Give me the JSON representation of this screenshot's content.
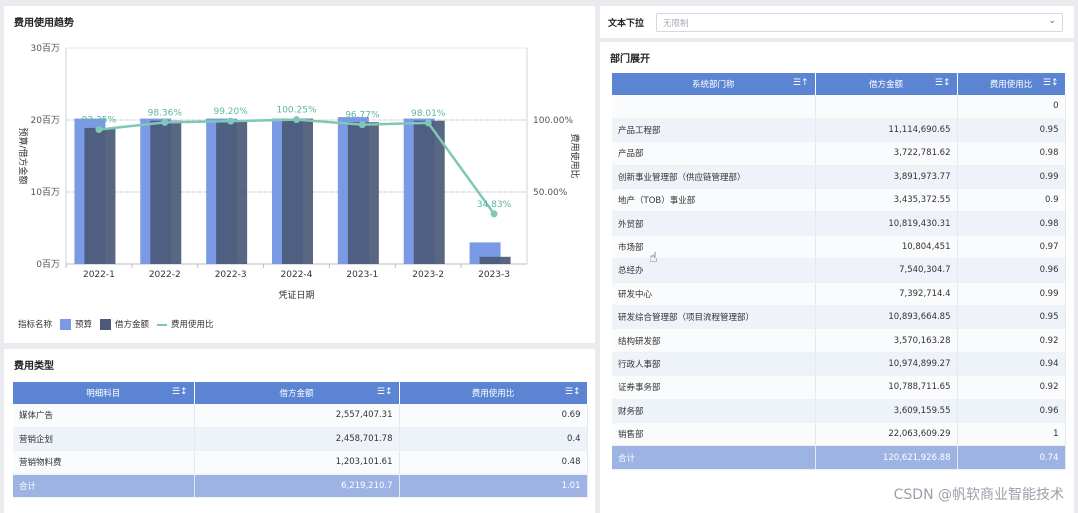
{
  "trend_panel": {
    "title": "费用使用趋势",
    "legend": {
      "label": "指标名称",
      "items": [
        "预算",
        "借方金额",
        "费用使用比"
      ]
    }
  },
  "chart_data": {
    "type": "bar",
    "categories": [
      "2022-1",
      "2022-2",
      "2022-3",
      "2022-4",
      "2023-1",
      "2023-2",
      "2023-3"
    ],
    "series": [
      {
        "name": "预算",
        "type": "bar",
        "color": "#7b9ae6",
        "values": [
          20.2,
          20.2,
          20.2,
          20.2,
          20.4,
          20.2,
          3.0
        ]
      },
      {
        "name": "借方金额",
        "type": "bar",
        "color": "#4b5a78",
        "values": [
          18.9,
          19.9,
          20.0,
          20.2,
          19.7,
          19.9,
          1.0
        ]
      },
      {
        "name": "费用使用比",
        "type": "line",
        "color": "#7fc8b8",
        "values": [
          93.35,
          98.36,
          99.2,
          100.25,
          96.77,
          98.01,
          34.83
        ],
        "labels": [
          "93.35%",
          "98.36%",
          "99.20%",
          "100.25%",
          "96.77%",
          "98.01%",
          "34.83%"
        ]
      }
    ],
    "xlabel": "凭证日期",
    "ylabel": "预算/借方金额",
    "y2label": "费用使用比",
    "ylim": [
      0,
      30
    ],
    "y2lim": [
      0,
      150
    ],
    "yticks": [
      "0百万",
      "10百万",
      "20百万",
      "30百万"
    ],
    "y2ticks": [
      "50.00%",
      "100.00%"
    ],
    "grid": true
  },
  "type_panel": {
    "title": "费用类型",
    "columns": [
      "明细科目",
      "借方金额",
      "费用使用比"
    ],
    "rows": [
      [
        "媒体广告",
        "2,557,407.31",
        "0.69"
      ],
      [
        "营销企划",
        "2,458,701.78",
        "0.4"
      ],
      [
        "营销物料费",
        "1,203,101.61",
        "0.48"
      ]
    ],
    "total": [
      "合计",
      "6,219,210.7",
      "1.01"
    ]
  },
  "filter": {
    "label": "文本下拉",
    "placeholder": "无限制"
  },
  "dept_panel": {
    "title": "部门展开",
    "columns": [
      "系统部门称",
      "借方金额",
      "费用使用比"
    ],
    "rows": [
      [
        "",
        "",
        "0"
      ],
      [
        "产品工程部",
        "11,114,690.65",
        "0.95"
      ],
      [
        "产品部",
        "3,722,781.62",
        "0.98"
      ],
      [
        "创新事业管理部（供应链管理部）",
        "3,891,973.77",
        "0.99"
      ],
      [
        "地产（TOB）事业部",
        "3,435,372.55",
        "0.9"
      ],
      [
        "外贸部",
        "10,819,430.31",
        "0.98"
      ],
      [
        "市场部",
        "10,804,451",
        "0.97"
      ],
      [
        "总经办",
        "7,540,304.7",
        "0.96"
      ],
      [
        "研发中心",
        "7,392,714.4",
        "0.99"
      ],
      [
        "研发综合管理部（项目流程管理部）",
        "10,893,664.85",
        "0.95"
      ],
      [
        "结构研发部",
        "3,570,163.28",
        "0.92"
      ],
      [
        "行政人事部",
        "10,974,899.27",
        "0.94"
      ],
      [
        "证券事务部",
        "10,788,711.65",
        "0.92"
      ],
      [
        "财务部",
        "3,609,159.55",
        "0.96"
      ],
      [
        "销售部",
        "22,063,609.29",
        "1"
      ]
    ],
    "total": [
      "合计",
      "120,621,926.88",
      "0.74"
    ]
  },
  "watermark": "CSDN @帆软商业智能技术"
}
